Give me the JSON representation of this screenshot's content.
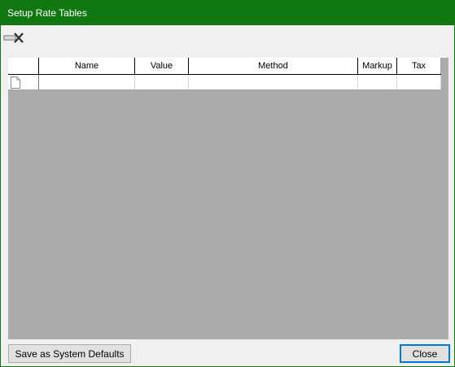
{
  "window": {
    "title": "Setup Rate Tables"
  },
  "toolbar": {
    "remove_icon": "remove-row-icon"
  },
  "grid": {
    "columns": [
      "Name",
      "Value",
      "Method",
      "Markup",
      "Tax"
    ],
    "rows": [
      {
        "new_row_icon": "new-row-document-icon",
        "cells": [
          "",
          "",
          "",
          "",
          ""
        ]
      }
    ]
  },
  "footer": {
    "save_defaults_label": "Save as System Defaults",
    "close_label": "Close"
  },
  "colors": {
    "titlebar": "#117811",
    "grid_background": "#ababab",
    "focus_border": "#0078d7"
  }
}
